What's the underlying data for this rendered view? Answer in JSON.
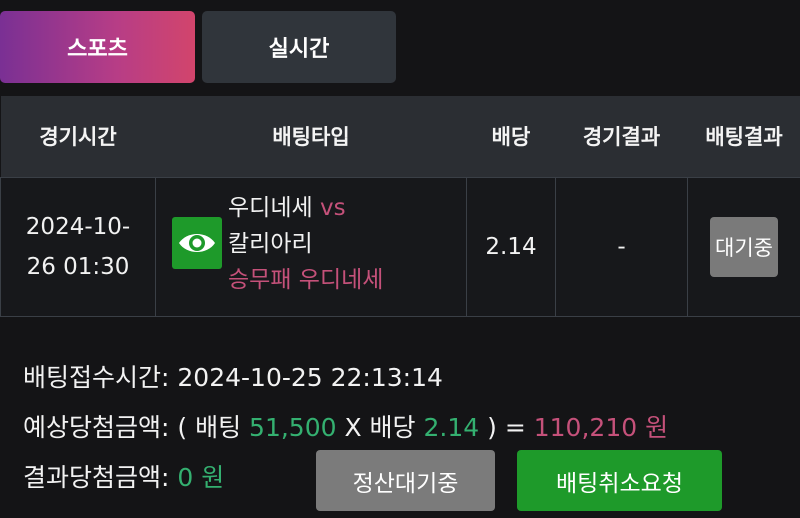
{
  "tabs": [
    {
      "label": "스포츠",
      "active": true
    },
    {
      "label": "실시간",
      "active": false
    }
  ],
  "table": {
    "headers": [
      "경기시간",
      "배팅타입",
      "배당",
      "경기결과",
      "배팅결과"
    ],
    "row": {
      "time_line1": "2024-10-",
      "time_line2": "26 01:30",
      "icon": "eye-icon",
      "home_team": "우디네세",
      "vs": "vs",
      "away_team": "칼리아리",
      "pick": "승무패 우디네세",
      "odds": "2.14",
      "match_result": "-",
      "bet_status": "대기중"
    }
  },
  "info": {
    "received_label": "배팅접수시간:",
    "received_value": "2024-10-25 22:13:14",
    "expected_label": "예상당첨금액:",
    "open_paren": "( 배팅",
    "stake": "51,500",
    "x_odds_label": "X 배당",
    "odds": "2.14",
    "close_paren": ") =",
    "payout": "110,210 원",
    "result_label": "결과당첨금액:",
    "result_value": "0 원"
  },
  "buttons": {
    "pending": "정산대기중",
    "cancel_request": "배팅취소요청"
  },
  "colors": {
    "accent_pink": "#c5517a",
    "accent_green": "#34b070",
    "button_green": "#1e9a2a"
  }
}
